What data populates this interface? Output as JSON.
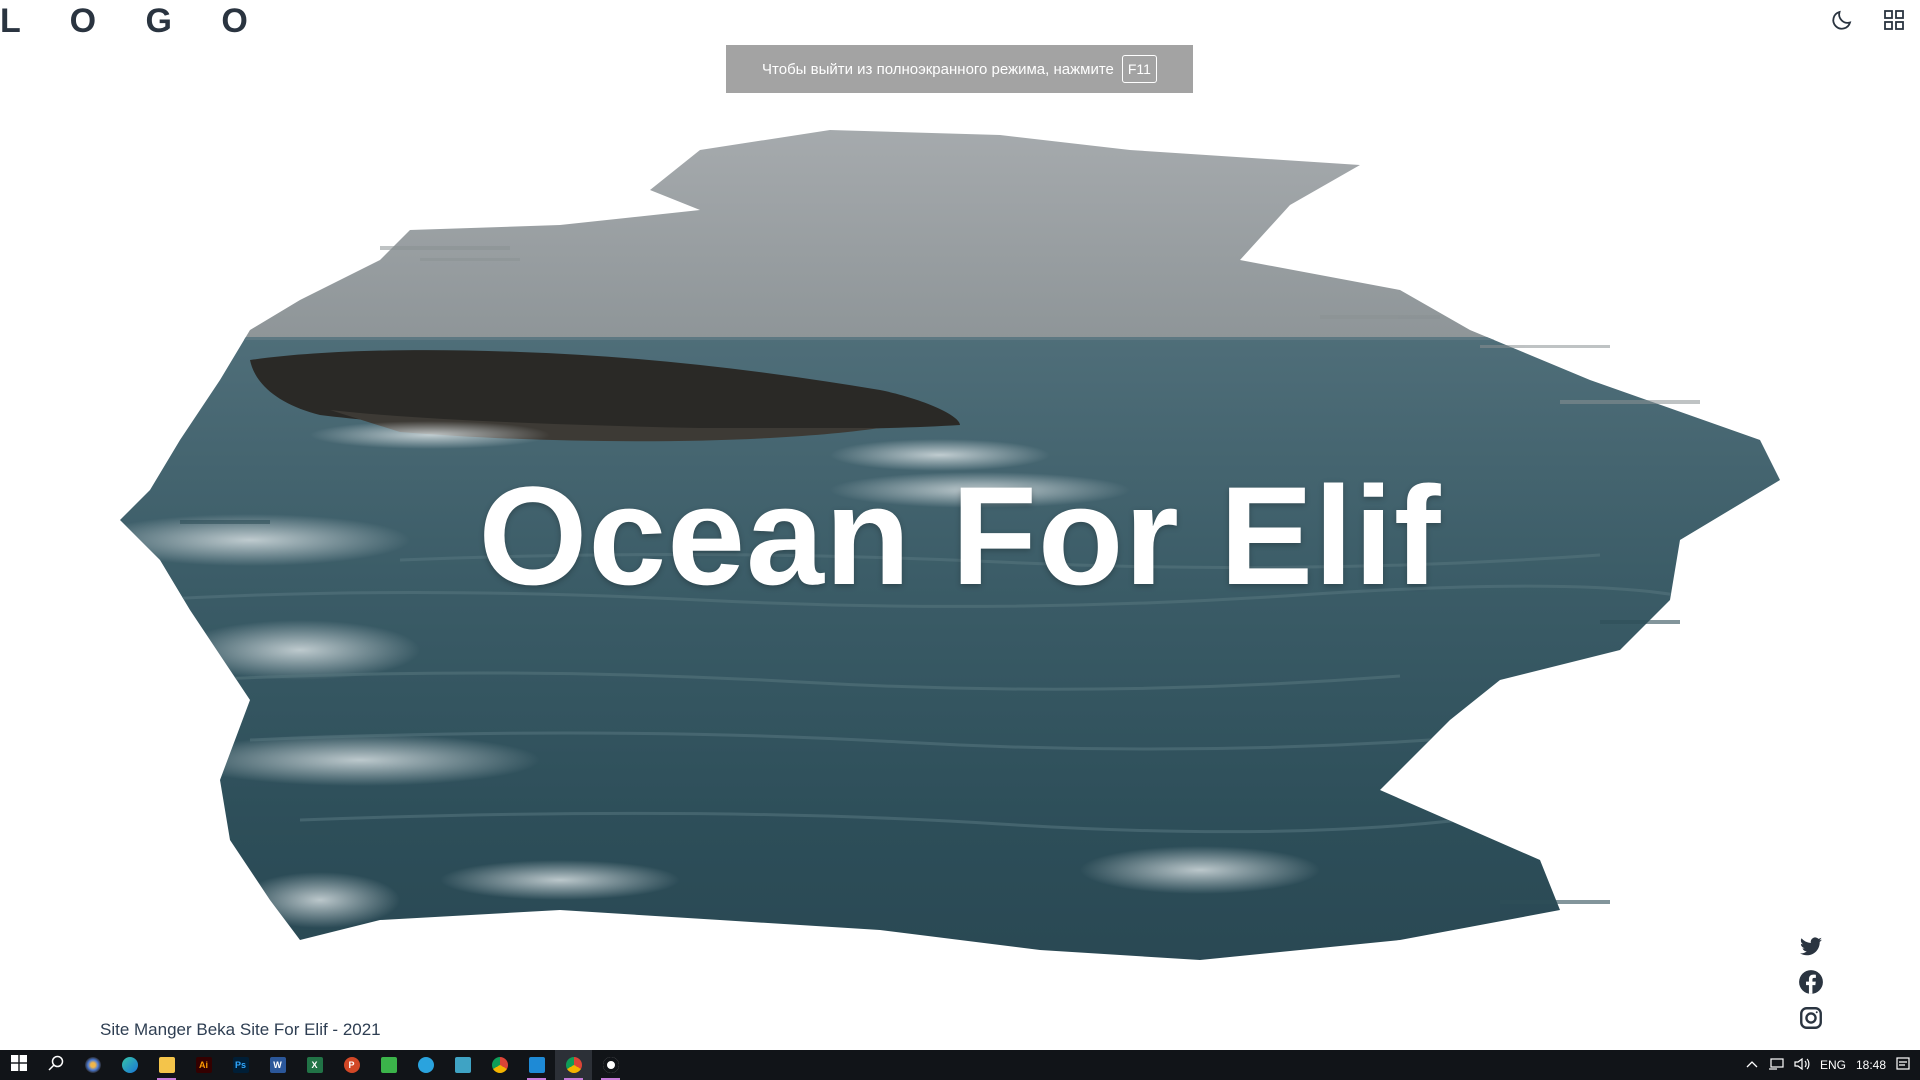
{
  "header": {
    "logo": "L O G O"
  },
  "banner": {
    "text": "Чтобы выйти из полноэкранного режима, нажмите",
    "key": "F11"
  },
  "hero": {
    "title": "Ocean For Elif"
  },
  "footer": {
    "text": "Site Manger Beka Site For Elif - 2021"
  },
  "icons": {
    "theme_toggle": "moon-icon",
    "menu": "grid-icon",
    "social": [
      "twitter-icon",
      "facebook-icon",
      "instagram-icon"
    ]
  },
  "taskbar": {
    "apps": [
      "start-icon",
      "search-icon",
      "davinci-icon",
      "edge-icon",
      "file-explorer-icon",
      "illustrator-icon",
      "photoshop-icon",
      "word-icon",
      "excel-icon",
      "powerpoint-icon",
      "greenapp-icon",
      "telegram-icon",
      "calculator-icon",
      "chrome-icon",
      "vscode-icon",
      "chrome-active-icon",
      "recorder-icon"
    ],
    "app_labels": {
      "illustrator": "Ai",
      "photoshop": "Ps",
      "word": "W",
      "excel": "X",
      "powerpoint": "P"
    },
    "tray_lang": "ENG",
    "tray_time": "18:48"
  },
  "colors": {
    "accent_text": "#2e3e52",
    "banner_bg": "#a3a3a3",
    "taskbar_bg": "#111418"
  }
}
